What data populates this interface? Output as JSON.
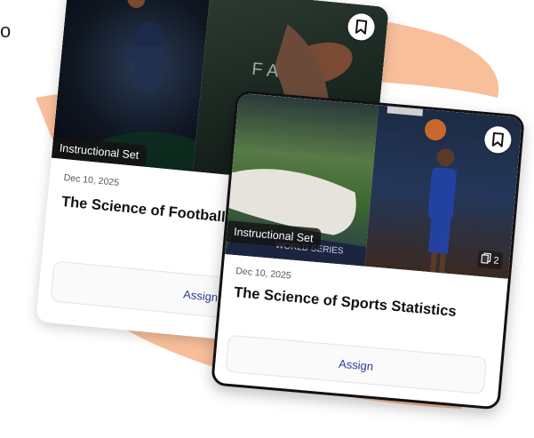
{
  "background": {
    "accent_color": "#f4a97a",
    "partial_text": "o"
  },
  "cards": [
    {
      "badge": "Instructional Set",
      "date": "Dec 10, 2025",
      "title": "The Science of Football",
      "assign_label": "Assign",
      "bookmark_icon": "bookmark-icon"
    },
    {
      "badge": "Instructional Set",
      "date": "Dec 10, 2025",
      "title": "The Science of Sports Statistics",
      "assign_label": "Assign",
      "bookmark_icon": "bookmark-icon",
      "item_count": "2",
      "count_icon": "copy-icon"
    }
  ],
  "colors": {
    "assign_text": "#2c3e8f",
    "badge_bg": "#141414"
  }
}
